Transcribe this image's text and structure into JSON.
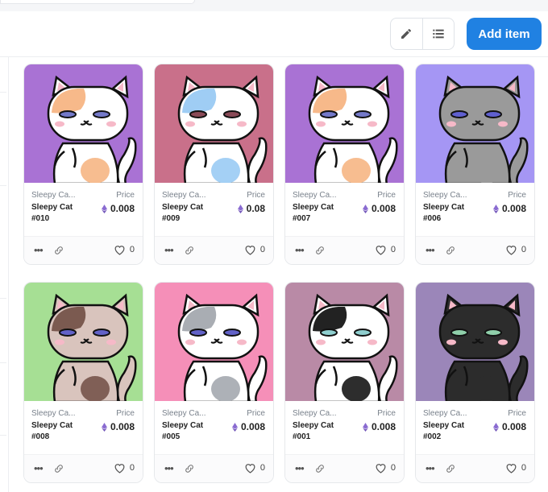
{
  "toolbar": {
    "add_label": "Add item",
    "edit_icon": "pencil-icon",
    "list_icon": "list-icon"
  },
  "items": [
    {
      "collection": "Sleepy Ca...",
      "name": "Sleepy Cat #010",
      "price_label": "Price",
      "price": "0.008",
      "likes": "0",
      "bg": "#a972d4",
      "body": "#ffffff",
      "patch": "#f7b98a",
      "eye": "#7479c9"
    },
    {
      "collection": "Sleepy Ca...",
      "name": "Sleepy Cat #009",
      "price_label": "Price",
      "price": "0.08",
      "likes": "0",
      "bg": "#c9708a",
      "body": "#ffffff",
      "patch": "#9fcdf4",
      "eye": "#8a4a57"
    },
    {
      "collection": "Sleepy Ca...",
      "name": "Sleepy Cat #007",
      "price_label": "Price",
      "price": "0.008",
      "likes": "0",
      "bg": "#a972d4",
      "body": "#ffffff",
      "patch": "#f7b98a",
      "eye": "#7479c9"
    },
    {
      "collection": "Sleepy Ca...",
      "name": "Sleepy Cat #006",
      "price_label": "Price",
      "price": "0.008",
      "likes": "0",
      "bg": "#a596f4",
      "body": "#9a9a9a",
      "patch": "#9a9a9a",
      "eye": "#5f5fcf"
    },
    {
      "collection": "Sleepy Ca...",
      "name": "Sleepy Cat #008",
      "price_label": "Price",
      "price": "0.008",
      "likes": "0",
      "bg": "#a6df94",
      "body": "#d9c4bd",
      "patch": "#7b5a50",
      "eye": "#6262c8"
    },
    {
      "collection": "Sleepy Ca...",
      "name": "Sleepy Cat #005",
      "price_label": "Price",
      "price": "0.008",
      "likes": "0",
      "bg": "#f58fb8",
      "body": "#ffffff",
      "patch": "#a9adb3",
      "eye": "#6262c8"
    },
    {
      "collection": "Sleepy Ca...",
      "name": "Sleepy Cat #001",
      "price_label": "Price",
      "price": "0.008",
      "likes": "0",
      "bg": "#b98aa6",
      "body": "#ffffff",
      "patch": "#222222",
      "eye": "#8fcfcf"
    },
    {
      "collection": "Sleepy Ca...",
      "name": "Sleepy Cat #002",
      "price_label": "Price",
      "price": "0.008",
      "likes": "0",
      "bg": "#9b86b9",
      "body": "#2c2c2c",
      "patch": "#2c2c2c",
      "eye": "#8fcfaa"
    }
  ],
  "card_icons": {
    "more": "more-dots-icon",
    "link": "link-icon",
    "like": "heart-icon",
    "currency": "ethereum-icon"
  }
}
